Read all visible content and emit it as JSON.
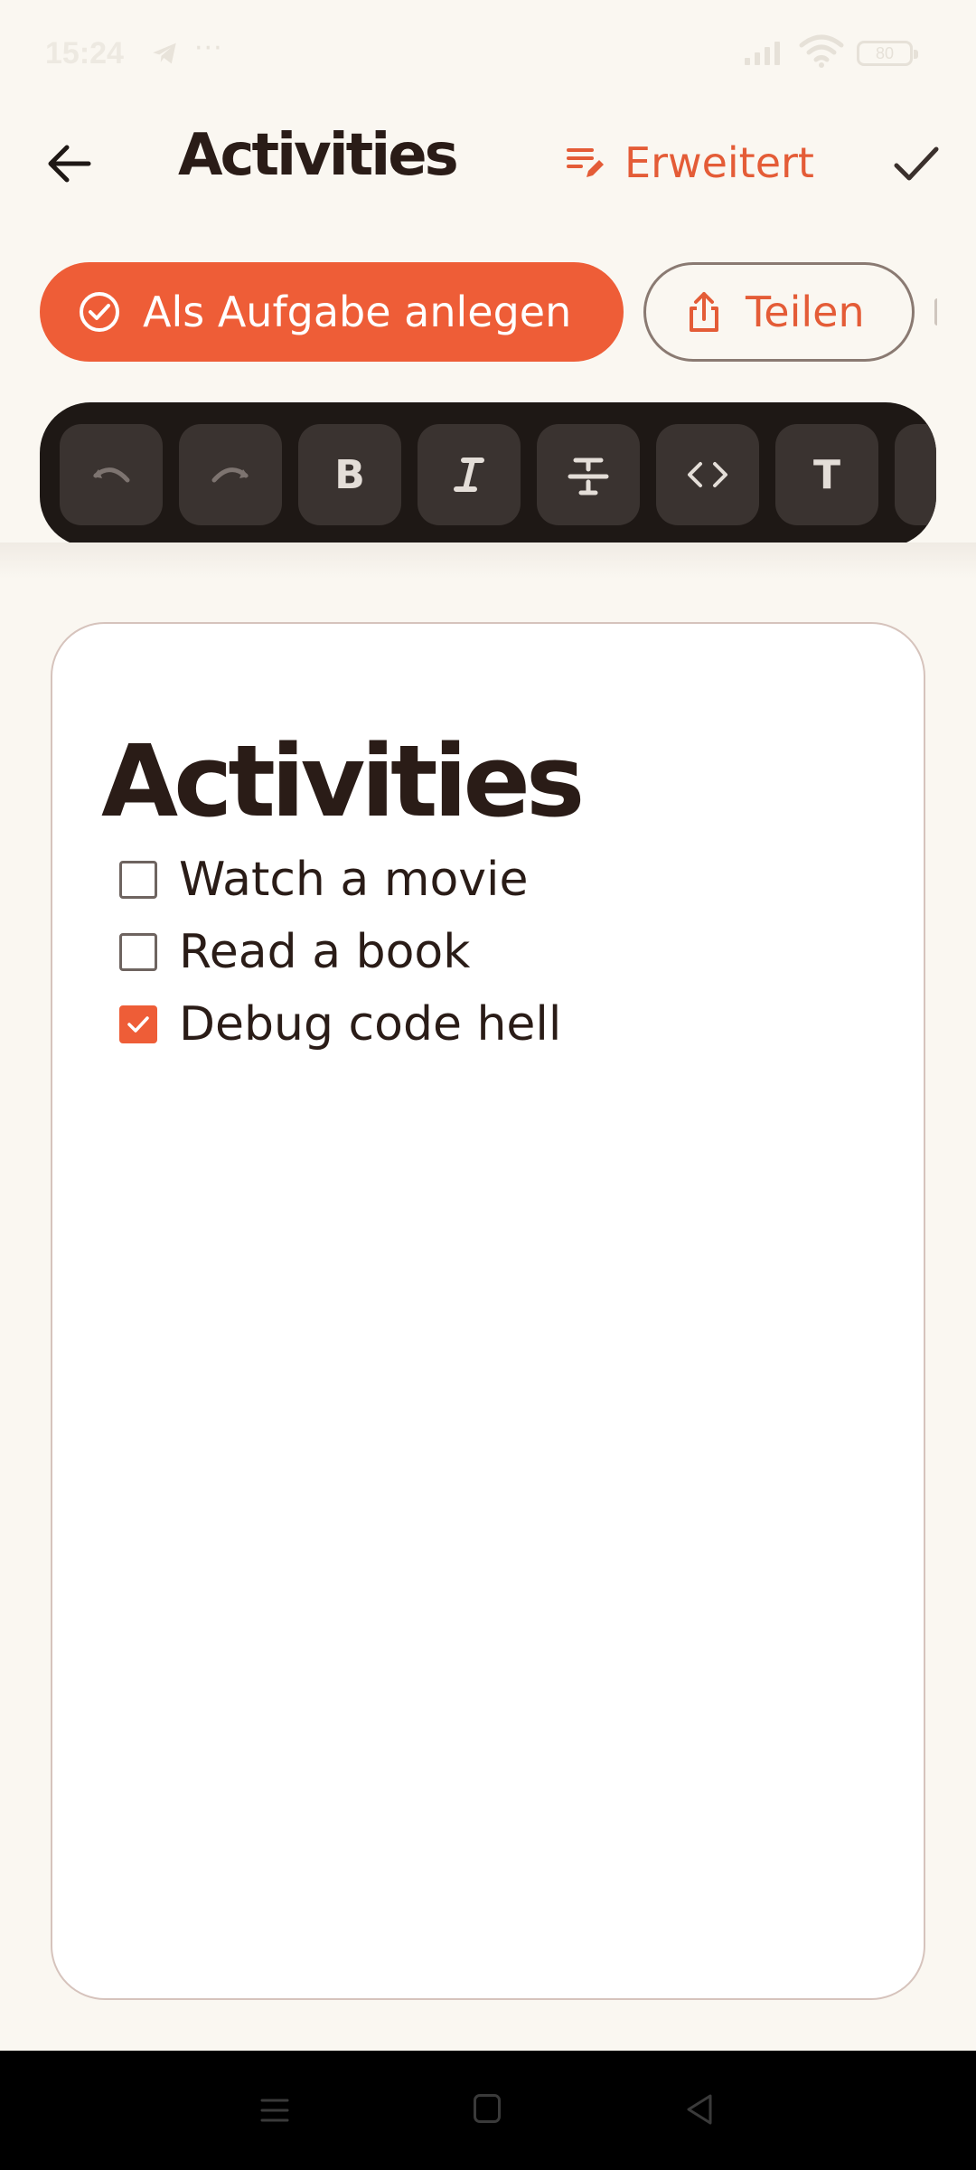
{
  "status_bar": {
    "time": "15:24",
    "dots": "···",
    "battery": "80"
  },
  "app_bar": {
    "title": "Activities",
    "advanced_label": "Erweitert"
  },
  "actions": {
    "create_task_label": "Als Aufgabe anlegen",
    "share_label": "Teilen"
  },
  "format_toolbar": {
    "bold": "B",
    "text_style": "T"
  },
  "document": {
    "title": "Activities",
    "items": [
      {
        "label": "Watch a movie",
        "checked": false
      },
      {
        "label": "Read a book",
        "checked": false
      },
      {
        "label": "Debug code hell",
        "checked": true
      }
    ]
  },
  "colors": {
    "accent": "#EE5D37",
    "background": "#FAF7F1",
    "toolbar": "#1E1815",
    "text": "#2A1C17"
  },
  "icons": {
    "back": "arrow-left-icon",
    "advanced": "edit-lines-icon",
    "done": "check-icon",
    "create_task": "check-circle-icon",
    "share": "share-icon",
    "undo": "undo-icon",
    "redo": "redo-icon",
    "italic": "italic-icon",
    "strikethrough": "strikethrough-icon",
    "code": "code-icon"
  }
}
